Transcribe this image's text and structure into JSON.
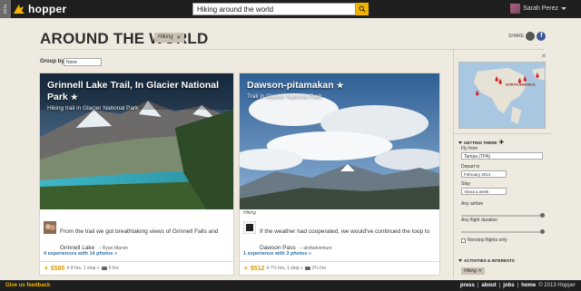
{
  "topbar": {
    "beta": "BETA",
    "logo": "hopper",
    "search_value": "Hiking around the world",
    "user_name": "Sarah Perez"
  },
  "header": {
    "title": "AROUND THE WORLD",
    "filter_tag": "Hiking",
    "share_label": "SHARE"
  },
  "groupby": {
    "label": "Group by",
    "value": "None"
  },
  "cards": [
    {
      "title": "Grinnell Lake Trail, In Glacier National Park",
      "subtitle": "Hiking trail in Glacier National Park",
      "quote": "From the trail we got breathtaking views of Grinnell Falls and Grinnell Lake",
      "author": "– Ryan Marvin",
      "experiences": "4 experiences with 14 photos »",
      "price": "$585",
      "trip": "rt 8 hrs, 1 stop »",
      "drive": "3 hrs",
      "tag": ""
    },
    {
      "title": "Dawson-pitamakan",
      "subtitle": "Trail in Glacier National Park",
      "quote": "If the weather had cooperated, we would've continued the loop to Dawson Pass",
      "author": "– als4adventure",
      "experiences": "1 experience with 3 photos »",
      "price": "$512",
      "trip": "rt 7½ hrs, 1 stop »",
      "drive": "2¾ hrs",
      "tag": "Hiking"
    }
  ],
  "sidebar": {
    "map_label": "NORTH AMERICA",
    "getting_there": "GETTING THERE",
    "fly_from_label": "Fly from",
    "fly_from_value": "Tampa (TPA)",
    "depart_label": "Depart in",
    "depart_value": "February 2014",
    "stay_label": "Stay",
    "stay_value": "About a week",
    "airfare_label": "Any airfare",
    "duration_label": "Any flight duration",
    "nonstop_label": "Nonstop flights only",
    "activities": "ACTIVITIES & INTERESTS",
    "activity_tag": "Hiking"
  },
  "footer": {
    "feedback": "Give us feedback",
    "links": [
      "press",
      "about",
      "jobs",
      "home"
    ],
    "copyright": "© 2013 Hopper"
  },
  "colors": {
    "accent": "#f3b400",
    "link": "#2a6fa8",
    "bar": "#1f1f1f"
  }
}
